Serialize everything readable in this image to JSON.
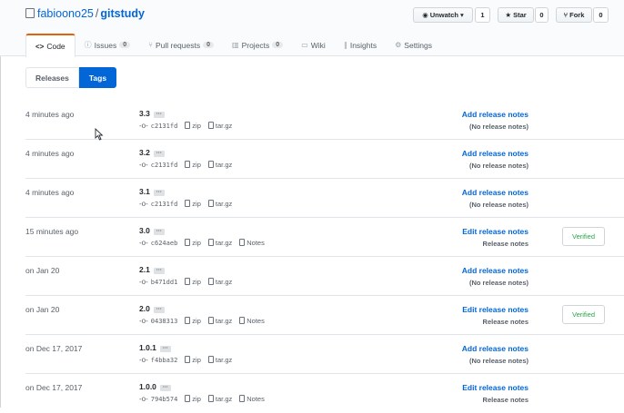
{
  "repo": {
    "owner": "fabioono25",
    "separator": "/",
    "name": "gitstudy"
  },
  "actions": {
    "watch": {
      "label": "Unwatch",
      "count": "1"
    },
    "star": {
      "label": "Star",
      "count": "0"
    },
    "fork": {
      "label": "Fork",
      "count": "0"
    }
  },
  "tabs": [
    {
      "label": "Code",
      "icon": "code-icon",
      "count": ""
    },
    {
      "label": "Issues",
      "icon": "issue-icon",
      "count": "0"
    },
    {
      "label": "Pull requests",
      "icon": "pull-request-icon",
      "count": "0"
    },
    {
      "label": "Projects",
      "icon": "project-icon",
      "count": "0"
    },
    {
      "label": "Wiki",
      "icon": "book-icon",
      "count": ""
    },
    {
      "label": "Insights",
      "icon": "graph-icon",
      "count": ""
    },
    {
      "label": "Settings",
      "icon": "gear-icon",
      "count": ""
    }
  ],
  "subnav": {
    "releases": "Releases",
    "tags": "Tags"
  },
  "download_labels": {
    "zip": "zip",
    "targz": "tar.gz",
    "notes": "Notes"
  },
  "ellipsis": "···",
  "tags": [
    {
      "time": "4 minutes ago",
      "name": "3.3",
      "sha": "c2131fd",
      "action": "Add release notes",
      "note": "(No release notes)",
      "notes_link": false,
      "verified": ""
    },
    {
      "time": "4 minutes ago",
      "name": "3.2",
      "sha": "c2131fd",
      "action": "Add release notes",
      "note": "(No release notes)",
      "notes_link": false,
      "verified": ""
    },
    {
      "time": "4 minutes ago",
      "name": "3.1",
      "sha": "c2131fd",
      "action": "Add release notes",
      "note": "(No release notes)",
      "notes_link": false,
      "verified": ""
    },
    {
      "time": "15 minutes ago",
      "name": "3.0",
      "sha": "c624aeb",
      "action": "Edit release notes",
      "note": "Release notes",
      "notes_link": true,
      "verified": "Verified"
    },
    {
      "time": "on Jan 20",
      "name": "2.1",
      "sha": "b471dd1",
      "action": "Add release notes",
      "note": "(No release notes)",
      "notes_link": false,
      "verified": ""
    },
    {
      "time": "on Jan 20",
      "name": "2.0",
      "sha": "0438313",
      "action": "Edit release notes",
      "note": "Release notes",
      "notes_link": true,
      "verified": "Verified"
    },
    {
      "time": "on Dec 17, 2017",
      "name": "1.0.1",
      "sha": "f4bba32",
      "action": "Add release notes",
      "note": "(No release notes)",
      "notes_link": false,
      "verified": ""
    },
    {
      "time": "on Dec 17, 2017",
      "name": "1.0.0",
      "sha": "794b574",
      "action": "Edit release notes",
      "note": "Release notes",
      "notes_link": true,
      "verified": ""
    }
  ],
  "colors": {
    "link": "#0366d6",
    "accent_tab": "#e36209",
    "verified": "#28a745",
    "selected_subnav": "#0366d6"
  }
}
